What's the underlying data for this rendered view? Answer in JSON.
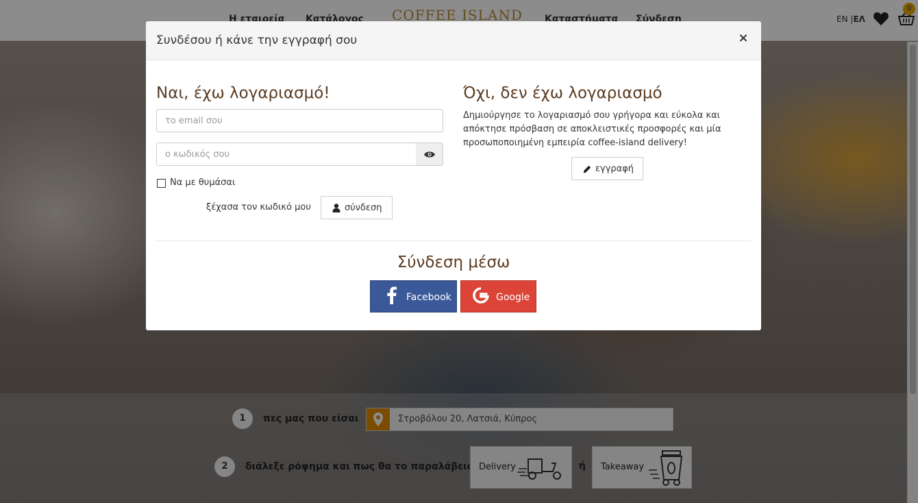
{
  "header": {
    "nav": [
      "Η εταιρεία",
      "Κατάλογος",
      "Καταστήματα",
      "Σύνδεση"
    ],
    "logo_text": "COFFEE ISLAND",
    "lang_en": "EN",
    "lang_sep": "|",
    "lang_el": "ΕΛ",
    "cart_count": "0"
  },
  "order": {
    "step1_num": "1",
    "step1_label": "πες μας που είσαι",
    "address": "Στροβόλου 20, Λατσιά, Κύπρος",
    "step2_num": "2",
    "step2_label": "διάλεξε ρόφημα και πως θα το παραλάβεις",
    "delivery": "Delivery",
    "or": "ή",
    "takeaway": "Takeaway"
  },
  "modal": {
    "title": "Συνδέσου ή κάνε την εγγραφή σου",
    "close": "×",
    "login": {
      "heading": "Ναι, έχω λογαριασμό!",
      "email_placeholder": "το email σου",
      "password_placeholder": "ο κωδικός σου",
      "remember": "Να με θυμάσαι",
      "forgot": "ξέχασα τον κωδικό μου",
      "submit": "σύνδεση"
    },
    "register": {
      "heading": "Όχι, δεν έχω λογαριασμό",
      "text": "Δημιούργησε το λογαριασμό σου γρήγορα και εύκολα και απόκτησε πρόσβαση σε αποκλειστικές προσφορές και μία προσωποποιημένη εμπειρία coffee-island delivery!",
      "button": "εγγραφή"
    },
    "social": {
      "heading": "Σύνδεση μέσω",
      "facebook": "Facebook",
      "google": "Google"
    }
  },
  "colors": {
    "accent_brown": "#5b3c23",
    "facebook": "#3b5998",
    "google": "#db4437",
    "brand_gold": "#b48a34"
  }
}
